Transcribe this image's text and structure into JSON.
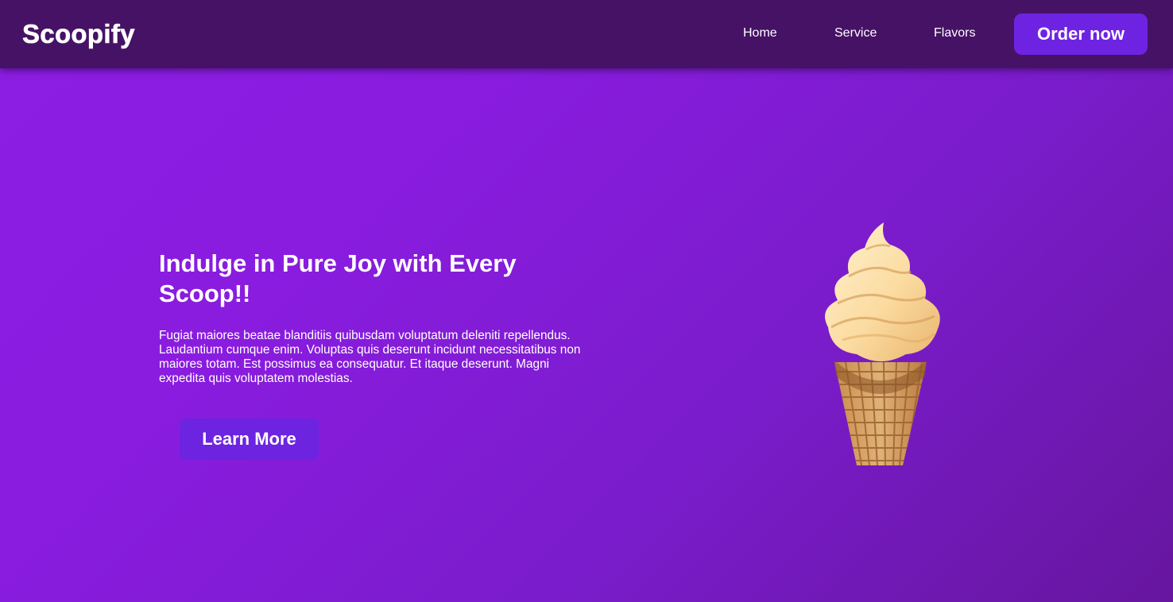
{
  "header": {
    "logo": "Scoopify",
    "nav": {
      "home": "Home",
      "service": "Service",
      "flavors": "Flavors"
    },
    "cta_label": "Order now"
  },
  "hero": {
    "title": "Indulge in Pure Joy with Every Scoop!!",
    "description": "Fugiat maiores beatae blanditiis quibusdam voluptatum deleniti repellendus. Laudantium cumque enim. Voluptas quis deserunt incidunt necessitatibus non maiores totam. Est possimus ea consequatur. Et itaque deserunt. Magni expedita quis voluptatem molestias.",
    "button_label": "Learn More",
    "image": "ice-cream-cone-image"
  },
  "colors": {
    "navbar": "#461266",
    "background_start": "#8c1de2",
    "background_end": "#66169f",
    "button": "#6f23e2",
    "text": "#ffffff"
  }
}
